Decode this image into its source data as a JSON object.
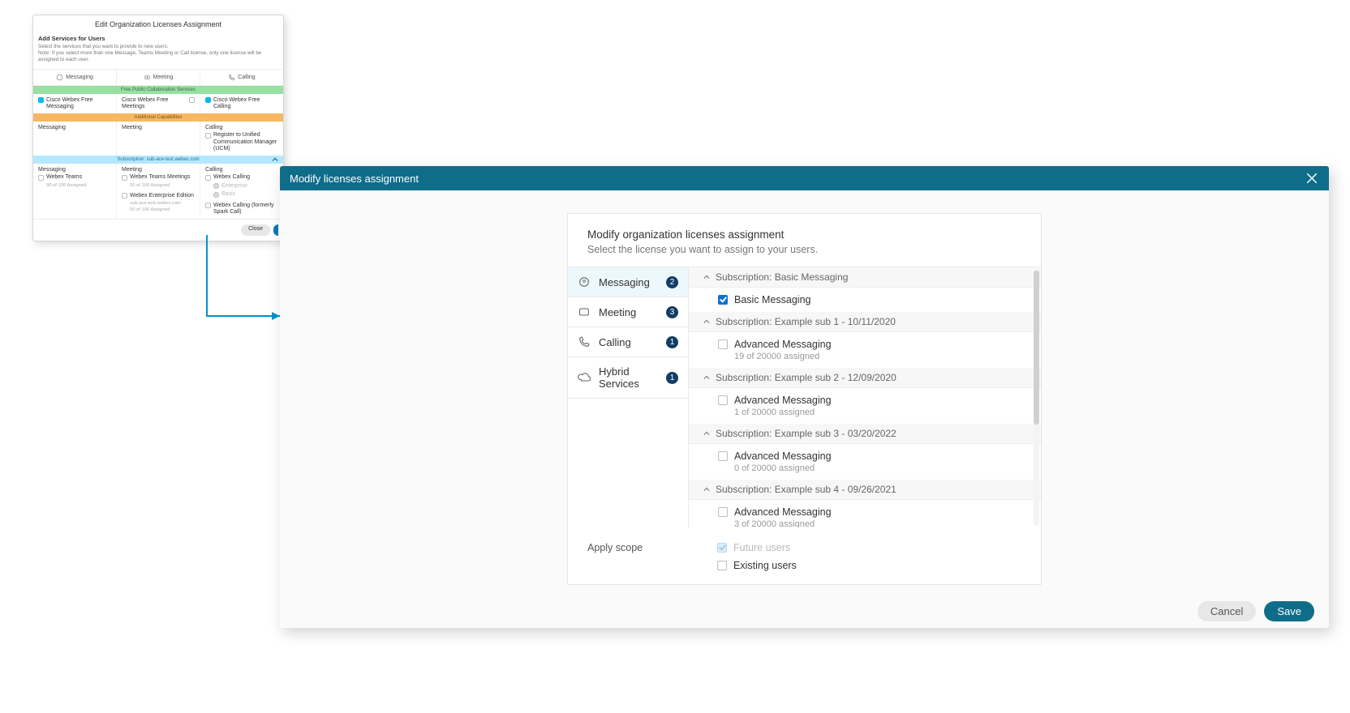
{
  "old": {
    "title": "Edit Organization Licenses Assignment",
    "section": "Add Services for Users",
    "line1": "Select the services that you want to provide to new users.",
    "line2": "Note: If you select more than one Message, Teams Meeting or Call license, only one license will be assigned to each user.",
    "tabs": {
      "msg": "Messaging",
      "meet": "Meeting",
      "call": "Calling"
    },
    "band_free": "Free Public Collaboration Services",
    "band_add": "Additional Capabilities",
    "band_sub": "Subscription: sub-ace-test.webex.com",
    "free": {
      "msg": "Cisco Webex Free Messaging",
      "meet": "Cisco Webex Free Meetings",
      "call": "Cisco Webex Free Calling"
    },
    "additional": {
      "msg_h": "Messaging",
      "meet_h": "Meeting",
      "call_h": "Calling",
      "call_opt": "Register to Unified Communication Manager (UCM)"
    },
    "subcol": {
      "msg_h": "Messaging",
      "msg_item": "Webex Teams",
      "msg_count": "90 of 100 Assigned",
      "meet_h": "Meeting",
      "meet_item1": "Webex Teams Meetings",
      "meet_count1": "50 of 100 Assigned",
      "meet_item2": "Webex Enterprise Edition",
      "meet_site": "sub-ace-test.webex.com",
      "meet_count2": "50 of 100 Assigned",
      "call_h": "Calling",
      "call_item1": "Webex Calling",
      "call_opt_e": "Enterprise",
      "call_opt_b": "Basic",
      "call_item2": "Webex Calling (formerly Spark Call)"
    },
    "close": "Close"
  },
  "new": {
    "title": "Modify licenses assignment",
    "h1": "Modify organization licenses assignment",
    "h2": "Select the license you want to assign to your users.",
    "cats": [
      {
        "key": "msg",
        "label": "Messaging",
        "badge": "2",
        "active": true
      },
      {
        "key": "meet",
        "label": "Meeting",
        "badge": "3",
        "active": false
      },
      {
        "key": "call",
        "label": "Calling",
        "badge": "1",
        "active": false
      },
      {
        "key": "hyb",
        "label": "Hybrid Services",
        "badge": "1",
        "active": false
      }
    ],
    "groups": [
      {
        "header": "Subscription: Basic Messaging",
        "items": [
          {
            "label": "Basic Messaging",
            "checked": true
          }
        ]
      },
      {
        "header": "Subscription: Example sub 1 - 10/11/2020",
        "items": [
          {
            "label": "Advanced Messaging",
            "sub": "19 of 20000 assigned"
          }
        ]
      },
      {
        "header": "Subscription: Example sub 2 - 12/09/2020",
        "items": [
          {
            "label": "Advanced Messaging",
            "sub": "1 of 20000 assigned"
          }
        ]
      },
      {
        "header": "Subscription: Example sub 3 - 03/20/2022",
        "items": [
          {
            "label": "Advanced Messaging",
            "sub": "0 of 20000 assigned"
          }
        ]
      },
      {
        "header": "Subscription: Example sub 4 - 09/26/2021",
        "items": [
          {
            "label": "Advanced Messaging",
            "sub": "3 of 20000 assigned"
          }
        ]
      }
    ],
    "scope": {
      "label": "Apply scope",
      "future": "Future users",
      "existing": "Existing users"
    },
    "cancel": "Cancel",
    "save": "Save"
  }
}
